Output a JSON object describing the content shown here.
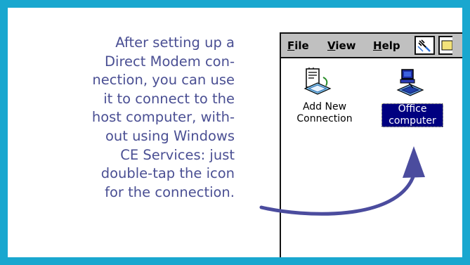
{
  "caption": "After setting up a\nDirect Modem con-\nnection, you can use\nit to connect to the\nhost computer, with-\nout using Windows\nCE Services: just\ndouble-tap the icon\nfor the connection.",
  "menu": {
    "file": {
      "first": "F",
      "rest": "ile"
    },
    "view": {
      "first": "V",
      "rest": "iew"
    },
    "help": {
      "first": "H",
      "rest": "elp"
    }
  },
  "icons": [
    {
      "label": "Add New\nConnection",
      "icon": "add-connection-icon",
      "selected": false
    },
    {
      "label": "Office\ncomputer",
      "icon": "office-computer-icon",
      "selected": true
    }
  ],
  "colors": {
    "frame": "#19a7cf",
    "caption_text": "#4a4f93",
    "arrow": "#4b4c9e",
    "selection": "#000080"
  }
}
